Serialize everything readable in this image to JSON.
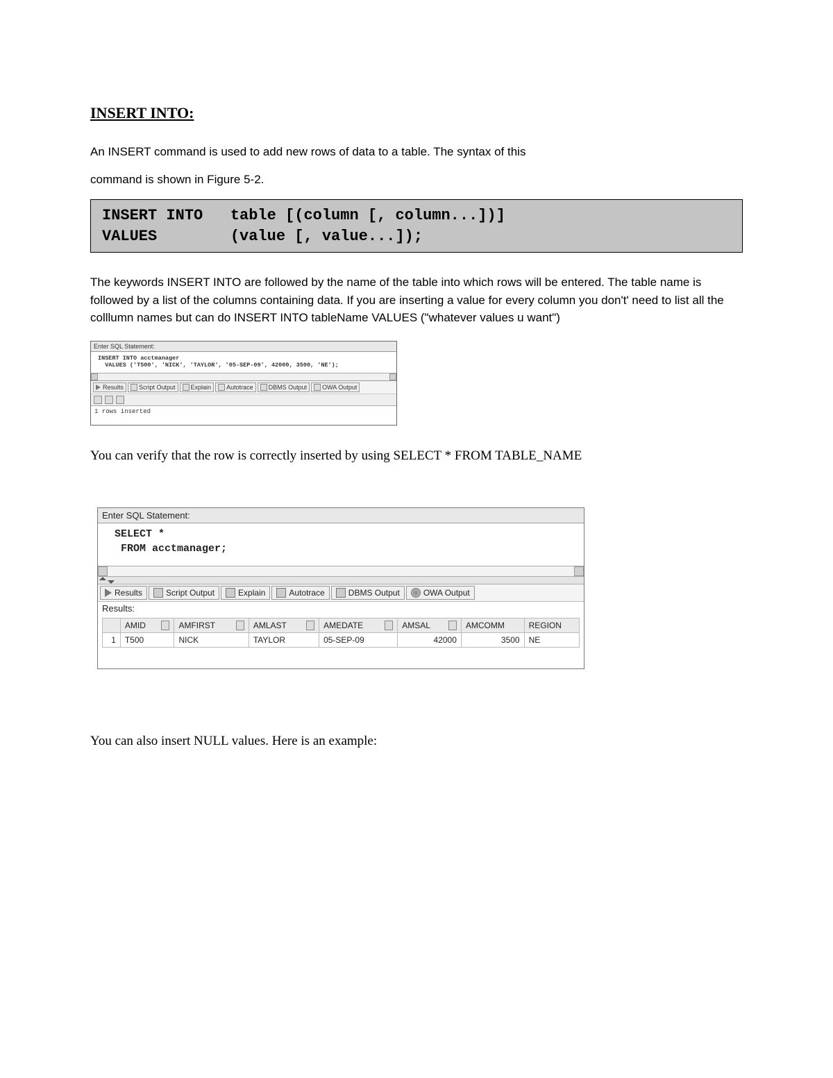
{
  "heading": "INSERT INTO:",
  "intro_p1": "An INSERT command is used to add new rows of data to a table. The syntax of this",
  "intro_p2": "command is shown in Figure 5-2.",
  "syntax_text": "INSERT INTO   table [(column [, column...])]\nVALUES        (value [, value...]);",
  "desc_p": "The keywords INSERT INTO are followed by the name of the table into which rows will be entered. The table name is followed by a list of the columns containing data.  If you are inserting a value for every column you don't' need to list all the colllumn names but can do INSERT INTO tableName VALUES (\"whatever values u want\")",
  "panel_small": {
    "title": "Enter SQL Statement:",
    "sql": "INSERT INTO acctmanager\n  VALUES ('T500', 'NICK', 'TAYLOR', '05-SEP-09', 42000, 3500, 'NE');",
    "tabs": [
      "Results",
      "Script Output",
      "Explain",
      "Autotrace",
      "DBMS Output",
      "OWA Output"
    ],
    "result": "1 rows inserted"
  },
  "verify_p": "You can verify that the row is correctly inserted by using SELECT * FROM TABLE_NAME",
  "panel_large": {
    "title": "Enter SQL Statement:",
    "sql": "SELECT *\n FROM acctmanager;",
    "tabs": [
      "Results",
      "Script Output",
      "Explain",
      "Autotrace",
      "DBMS Output",
      "OWA Output"
    ],
    "results_label": "Results:",
    "columns": [
      "",
      "AMID",
      "AMFIRST",
      "AMLAST",
      "AMEDATE",
      "AMSAL",
      "AMCOMM",
      "REGION"
    ],
    "row": {
      "idx": "1",
      "AMID": "T500",
      "AMFIRST": "NICK",
      "AMLAST": "TAYLOR",
      "AMEDATE": "05-SEP-09",
      "AMSAL": "42000",
      "AMCOMM": "3500",
      "REGION": "NE"
    }
  },
  "null_p": "You can also insert NULL values. Here is an example:"
}
